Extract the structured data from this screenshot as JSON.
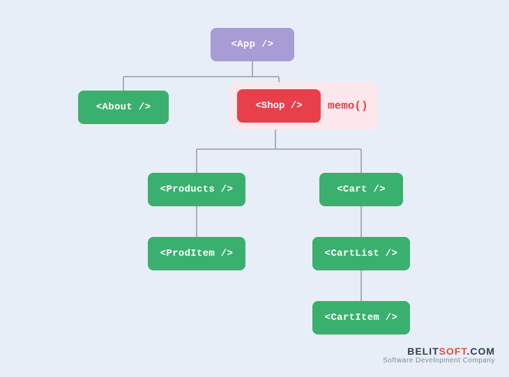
{
  "nodes": {
    "app": {
      "label": "<App />",
      "color": "#a89cd4"
    },
    "about": {
      "label": "<About />",
      "color": "#3ab06e"
    },
    "shop": {
      "label": "<Shop />",
      "color": "#e8404a"
    },
    "memo": {
      "label": "memo()"
    },
    "products": {
      "label": "<Products />",
      "color": "#3ab06e"
    },
    "cart": {
      "label": "<Cart />",
      "color": "#3ab06e"
    },
    "proditem": {
      "label": "<ProdItem />",
      "color": "#3ab06e"
    },
    "cartlist": {
      "label": "<CartList />",
      "color": "#3ab06e"
    },
    "cartitem": {
      "label": "<CartItem />",
      "color": "#3ab06e"
    }
  },
  "watermark": {
    "title": "BELIT",
    "title_accent": "SOFT",
    "domain": ".COM",
    "subtitle": "Software Development Company"
  }
}
